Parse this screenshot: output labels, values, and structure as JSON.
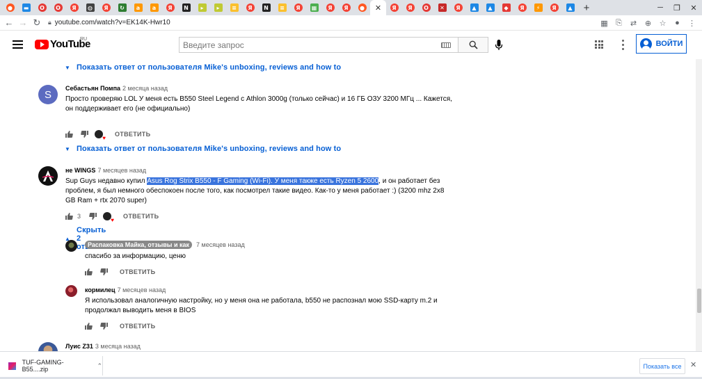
{
  "browser": {
    "url": "youtube.com/watch?v=EK14K-Hwr10",
    "tabs": [
      {
        "icon": "reddit-icon",
        "color": "#ff5722"
      },
      {
        "icon": "flag-icon",
        "color": "#1e88e5"
      },
      {
        "icon": "opera-icon",
        "color": "#e53935"
      },
      {
        "icon": "opera-icon",
        "color": "#e53935"
      },
      {
        "icon": "yandex-icon",
        "color": "#f44336"
      },
      {
        "icon": "globe-icon",
        "color": "#424242"
      },
      {
        "icon": "yandex-icon",
        "color": "#f44336"
      },
      {
        "icon": "sync-icon",
        "color": "#2e7d32"
      },
      {
        "icon": "amazon-icon",
        "color": "#ff9800"
      },
      {
        "icon": "amazon-icon",
        "color": "#ff9800"
      },
      {
        "icon": "yandex-icon",
        "color": "#f44336"
      },
      {
        "icon": "notion-icon",
        "color": "#222222"
      },
      {
        "icon": "bookmark-icon",
        "color": "#c0ca33"
      },
      {
        "icon": "bookmark-icon",
        "color": "#c0ca33"
      },
      {
        "icon": "beeline-icon",
        "color": "#fbc02d"
      },
      {
        "icon": "yandex-icon",
        "color": "#f44336"
      },
      {
        "icon": "notion-icon",
        "color": "#222222"
      },
      {
        "icon": "beeline-icon",
        "color": "#fbc02d"
      },
      {
        "icon": "yandex-icon",
        "color": "#f44336"
      },
      {
        "icon": "grid-icon",
        "color": "#4caf50"
      },
      {
        "icon": "yandex-icon",
        "color": "#f44336"
      },
      {
        "icon": "yandex-icon",
        "color": "#f44336"
      },
      {
        "icon": "reddit-icon",
        "color": "#ff5722"
      },
      {
        "icon": "close-icon",
        "color": "#333333",
        "active": true
      },
      {
        "icon": "yandex-icon",
        "color": "#f44336"
      },
      {
        "icon": "yandex-icon",
        "color": "#f44336"
      },
      {
        "icon": "opera-icon",
        "color": "#e53935"
      },
      {
        "icon": "xbox-icon",
        "color": "#c62828"
      },
      {
        "icon": "yandex-icon",
        "color": "#f44336"
      },
      {
        "icon": "arrow-icon",
        "color": "#1e88e5"
      },
      {
        "icon": "arrow-icon",
        "color": "#1e88e5"
      },
      {
        "icon": "asus-icon",
        "color": "#e53935"
      },
      {
        "icon": "yandex-icon",
        "color": "#f44336"
      },
      {
        "icon": "bolt-icon",
        "color": "#ff9800"
      },
      {
        "icon": "yandex-icon",
        "color": "#f44336"
      },
      {
        "icon": "arrow-icon",
        "color": "#1e88e5"
      }
    ]
  },
  "youtube": {
    "logo_text": "YouTube",
    "region": "RU",
    "search_placeholder": "Введите запрос",
    "signin_label": "ВОЙТИ"
  },
  "thread": {
    "show_reply_label": "Показать ответ от пользователя Mike's unboxing, reviews and how to",
    "hide_replies_label": "Скрыть 2 ответа",
    "reply_label": "ОТВЕТИТЬ"
  },
  "comments": {
    "c1": {
      "author": "Себастьян Помпа",
      "time": "2 месяца назад",
      "text": "Просто проверяю LOL У меня есть B550 Steel Legend с Athlon 3000g (только сейчас) и 16 ГБ ОЗУ 3200 МГц ... Кажется, он поддерживает его (не официально)",
      "avatar_letter": "S",
      "avatar_color": "#5c6bc0"
    },
    "c2": {
      "author": "не WINGS",
      "time": "7 месяцев назад",
      "text_before": "Sup Guys недавно купил ",
      "text_selected": "Asus Rog Strix B550 - F Gaming (Wi-Fi). У меня также есть Ryzen 5 2600",
      "text_after": ", и он работает без проблем, я был немного обеспокоен после того, как посмотрел такие видео. Как-то у меня работает :) (3200 mhz 2x8 GB Ram + rtx 2070 super)",
      "likes": "3",
      "selection_color": "#3a74dd"
    },
    "r1": {
      "author": "Распаковка Майка, отзывы и как",
      "time": "7 месяцев назад",
      "text": "спасибо за информацию, ценю"
    },
    "r2": {
      "author": "кормилец",
      "time": "7 месяцев назад",
      "text": "Я использовал аналогичную настройку, но у меня она не работала, b550 не распознал мою SSD-карту m.2 и продолжал выводить меня в BIOS"
    },
    "c3": {
      "author": "Луис Z31",
      "time": "3 месяца назад"
    }
  },
  "downloads": {
    "file_name": "TUF-GAMING-B55....zip",
    "show_all_label": "Показать все"
  },
  "colors": {
    "link_blue": "#065fd4",
    "logo_red": "#ff0000"
  }
}
